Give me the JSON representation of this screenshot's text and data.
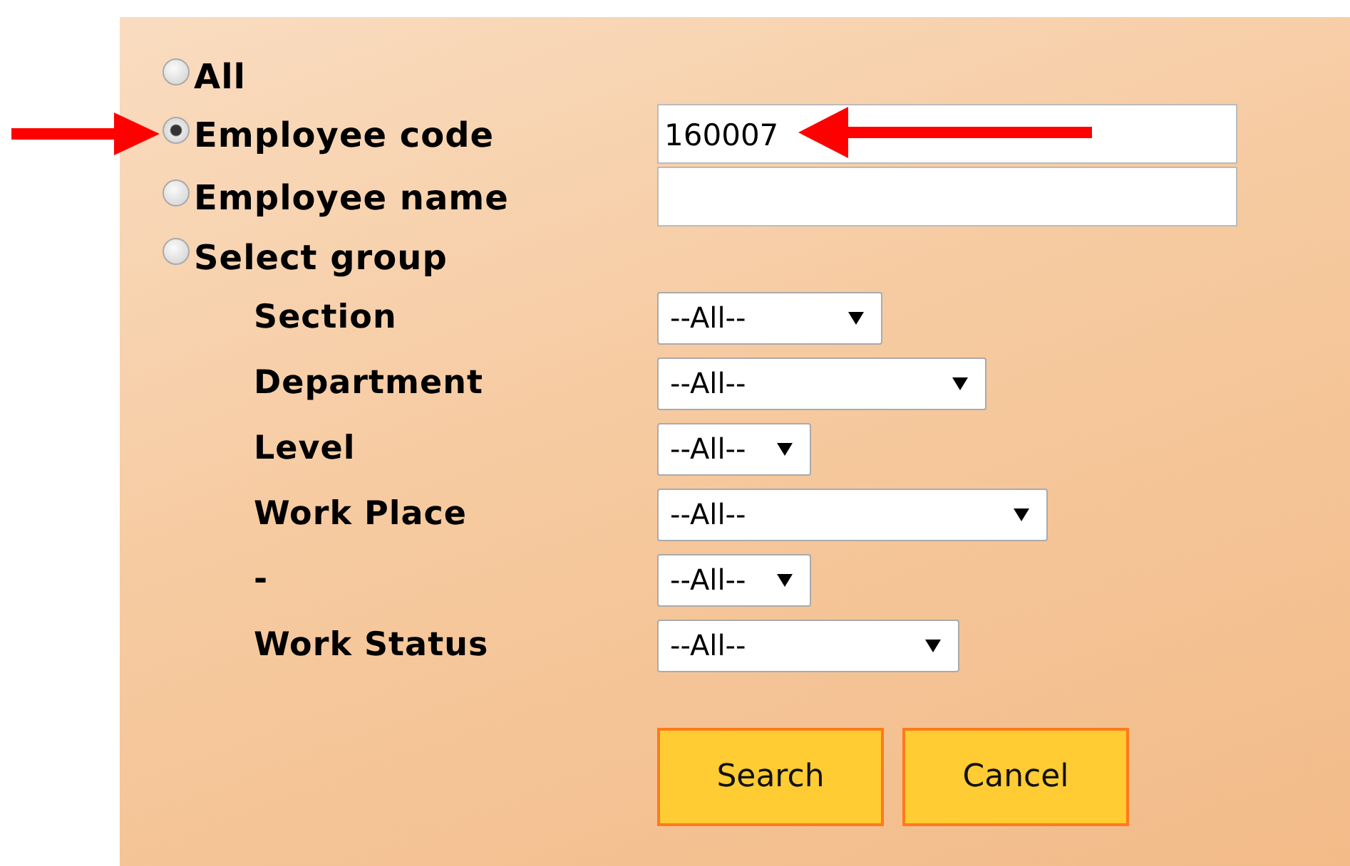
{
  "options": [
    {
      "label": "All",
      "selected": false,
      "kind": "plain"
    },
    {
      "label": "Employee code",
      "selected": true,
      "kind": "input",
      "value": "160007"
    },
    {
      "label": "Employee name",
      "selected": false,
      "kind": "input"
    },
    {
      "label": "Select group",
      "selected": false,
      "kind": "plain"
    }
  ],
  "group_filters": [
    {
      "label": "Section",
      "value": "--All--"
    },
    {
      "label": "Department",
      "value": "--All--"
    },
    {
      "label": "Level",
      "value": "--All--"
    },
    {
      "label": "Work Place",
      "value": "--All--"
    },
    {
      "label": "-",
      "value": "--All--"
    },
    {
      "label": "Work Status",
      "value": "--All--"
    }
  ],
  "buttons": [
    "Search",
    "Cancel"
  ]
}
